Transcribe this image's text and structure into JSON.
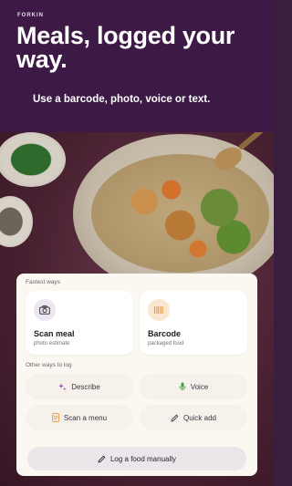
{
  "brand": "FORKIN",
  "headline": "Meals, logged your way.",
  "subtitle": "Use a barcode, photo, voice or text.",
  "fastest": {
    "label": "Fastest ways",
    "scan_meal": {
      "title": "Scan meal",
      "sub": "photo estimate",
      "icon": "camera-icon"
    },
    "barcode": {
      "title": "Barcode",
      "sub": "packaged food",
      "icon": "barcode-icon"
    }
  },
  "other": {
    "label": "Other ways to log",
    "describe": {
      "label": "Describe",
      "icon": "sparkle-icon"
    },
    "voice": {
      "label": "Voice",
      "icon": "microphone-icon"
    },
    "scan_menu": {
      "label": "Scan a menu",
      "icon": "menu-icon"
    },
    "quick_add": {
      "label": "Quick add",
      "icon": "pencil-icon"
    }
  },
  "manual": {
    "label": "Log a food manually",
    "icon": "pencil-icon"
  },
  "colors": {
    "header_bg": "#3c1a45",
    "accent_purple": "#8a4bb0",
    "accent_orange": "#e8963a",
    "accent_green": "#3f9a4a"
  }
}
